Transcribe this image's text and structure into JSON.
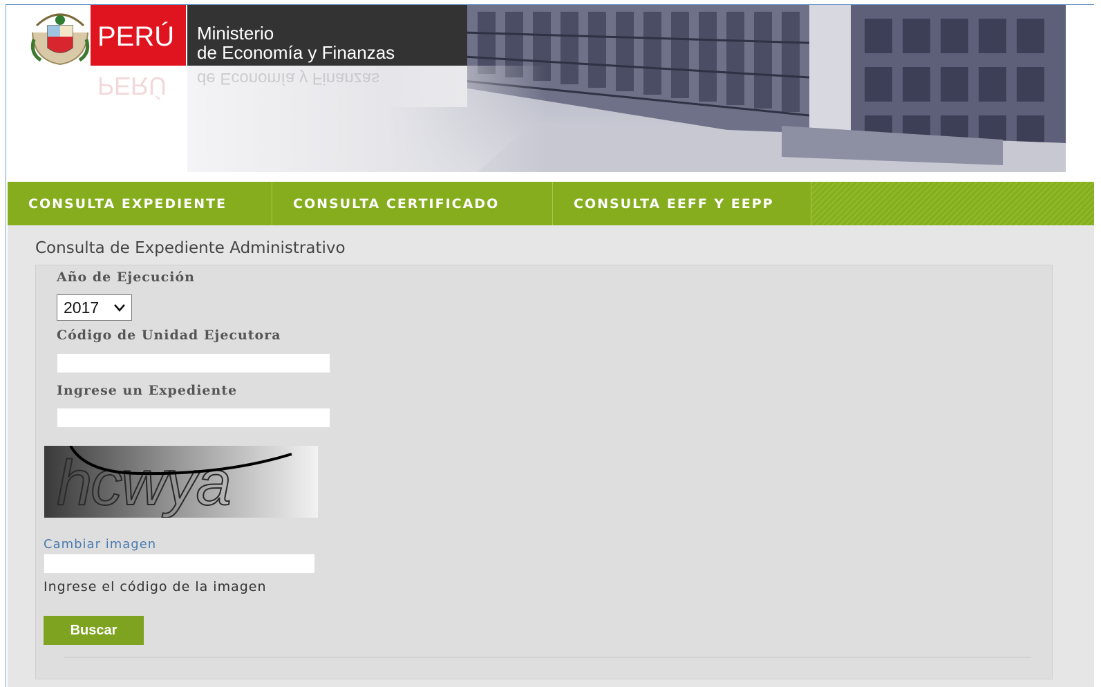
{
  "header": {
    "country": "PERÚ",
    "ministry_line1": "Ministerio",
    "ministry_line2": "de Economía y Finanzas",
    "ministry_reflection": "de Economía y Finanzas",
    "country_reflection": "PERÚ"
  },
  "nav": {
    "items": [
      {
        "label": "CONSULTA EXPEDIENTE"
      },
      {
        "label": "CONSULTA CERTIFICADO"
      },
      {
        "label": "CONSULTA EEFF Y EEPP"
      }
    ]
  },
  "form": {
    "title": "Consulta de Expediente Administrativo",
    "year_label": "Año de Ejecución",
    "year_value": "2017",
    "unit_label": "Código de Unidad Ejecutora",
    "unit_value": "",
    "expediente_label": "Ingrese un Expediente",
    "expediente_value": "",
    "captcha_text": "hcwya",
    "change_image_link": "Cambiar imagen",
    "captcha_value": "",
    "captcha_hint": "Ingrese el código de la imagen",
    "search_button": "Buscar"
  },
  "colors": {
    "nav_green": "#85ad1e",
    "peru_red": "#e0141e",
    "ministry_dark": "#333333",
    "link_blue": "#4a7ab0"
  },
  "icons": {
    "coat_of_arms": "peru-coat-of-arms-icon",
    "select_arrow": "chevron-down-icon"
  }
}
